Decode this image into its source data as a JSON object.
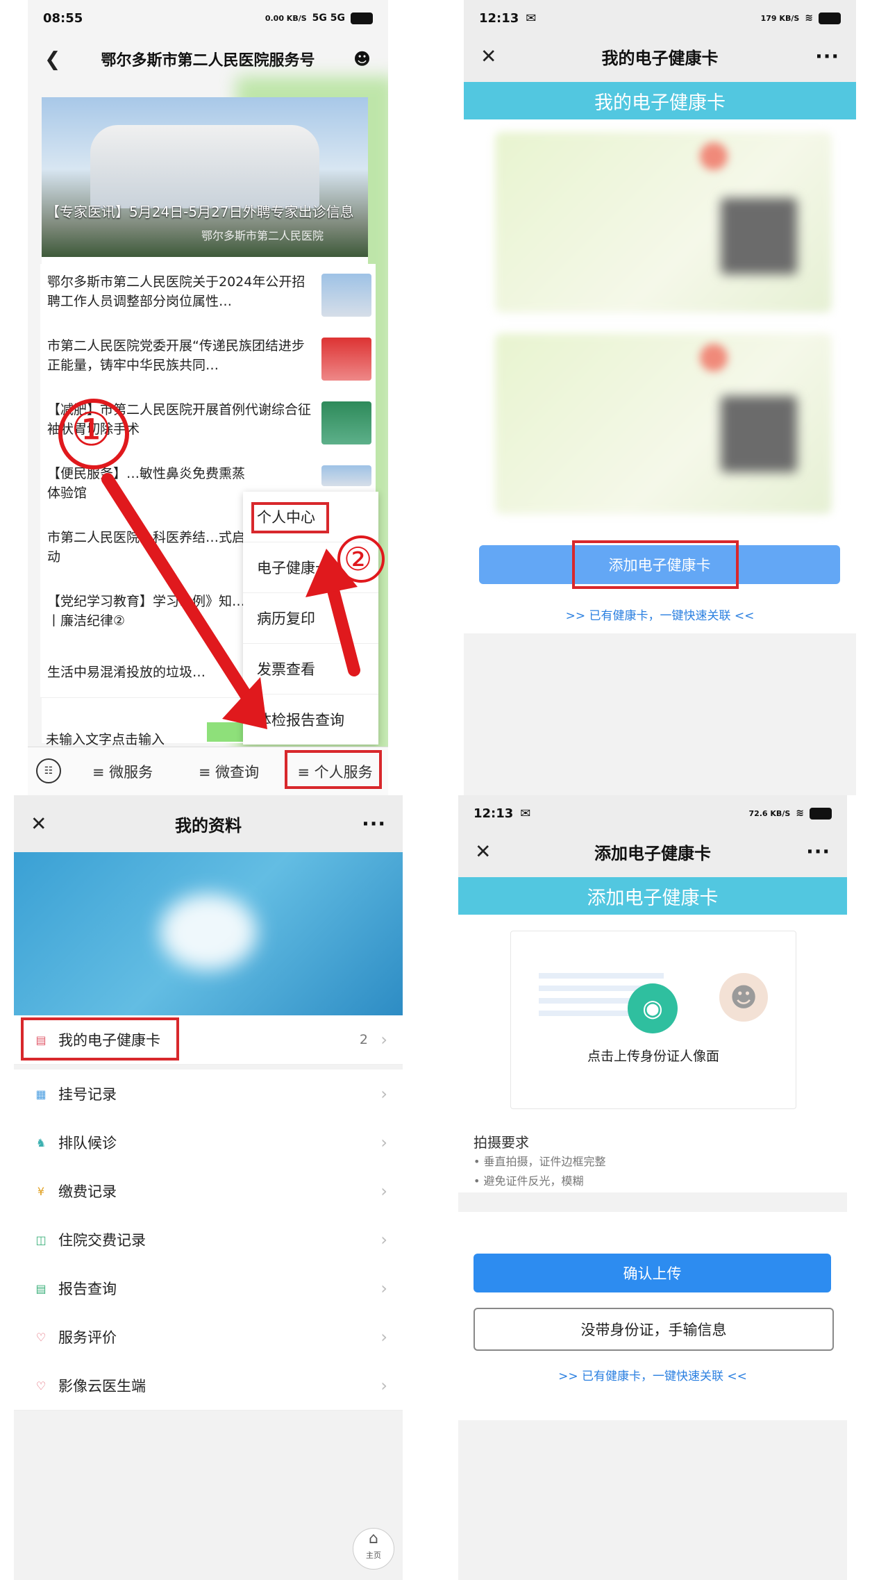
{
  "panel1": {
    "status": {
      "time": "08:55",
      "net": "0.00 KB/S",
      "signal": "5G 5G"
    },
    "nav": {
      "title": "鄂尔多斯市第二人民医院服务号"
    },
    "banner": {
      "caption": "【专家医讯】5月24日-5月27日外聘专家出诊信息",
      "source": "鄂尔多斯市第二人民医院"
    },
    "news": [
      "鄂尔多斯市第二人民医院关于2024年公开招聘工作人员调整部分岗位属性…",
      "市第二人民医院党委开展“传递民族团结进步正能量，铸牢中华民族共同…",
      "【减肥】市第二人民医院开展首例代谢综合征袖状胃切除手术",
      "【便民服务】…敏性鼻炎免费熏蒸体验馆",
      "市第二人民医院…科医养结…式启动",
      "【党纪学习教育】学习…例》知…丨廉洁纪律②",
      "生活中易混淆投放的垃圾…",
      "未输入文字点击输入"
    ],
    "menu": [
      "个人中心",
      "电子健康卡",
      "病历复印",
      "发票查看",
      "体检报告查询"
    ],
    "tabs": [
      "微服务",
      "微查询",
      "个人服务"
    ],
    "markers": [
      "①",
      "②"
    ]
  },
  "panel2": {
    "status": {
      "time": "12:13",
      "net": "179 KB/S"
    },
    "nav": {
      "title": "我的电子健康卡"
    },
    "header": "我的电子健康卡",
    "add_button": "添加电子健康卡",
    "link": ">> 已有健康卡，一键快速关联 <<"
  },
  "panel3": {
    "nav": {
      "title": "我的资料"
    },
    "rows": [
      {
        "label": "我的电子健康卡",
        "count": "2",
        "icon": "card-icon"
      },
      {
        "label": "挂号记录",
        "icon": "calendar-icon"
      },
      {
        "label": "排队候诊",
        "icon": "queue-icon"
      },
      {
        "label": "缴费记录",
        "icon": "payment-icon"
      },
      {
        "label": "住院交费记录",
        "icon": "hospital-bill-icon"
      },
      {
        "label": "报告查询",
        "icon": "report-icon"
      },
      {
        "label": "服务评价",
        "icon": "heart-icon"
      },
      {
        "label": "影像云医生端",
        "icon": "heart-icon"
      }
    ],
    "home_label": "主页"
  },
  "panel4": {
    "status": {
      "time": "12:13",
      "net": "72.6 KB/S"
    },
    "nav": {
      "title": "添加电子健康卡"
    },
    "header": "添加电子健康卡",
    "upload_hint": "点击上传身份证人像面",
    "req_title": "拍摄要求",
    "req_items": [
      "垂直拍摄，证件边框完整",
      "避免证件反光，模糊"
    ],
    "confirm_button": "确认上传",
    "manual_button": "没带身份证，手输信息",
    "link": ">> 已有健康卡，一键快速关联 <<"
  },
  "colors": {
    "accent_cyan": "#52c7e0",
    "button_blue": "#2d8cf0",
    "highlight_red": "#d8282c"
  }
}
